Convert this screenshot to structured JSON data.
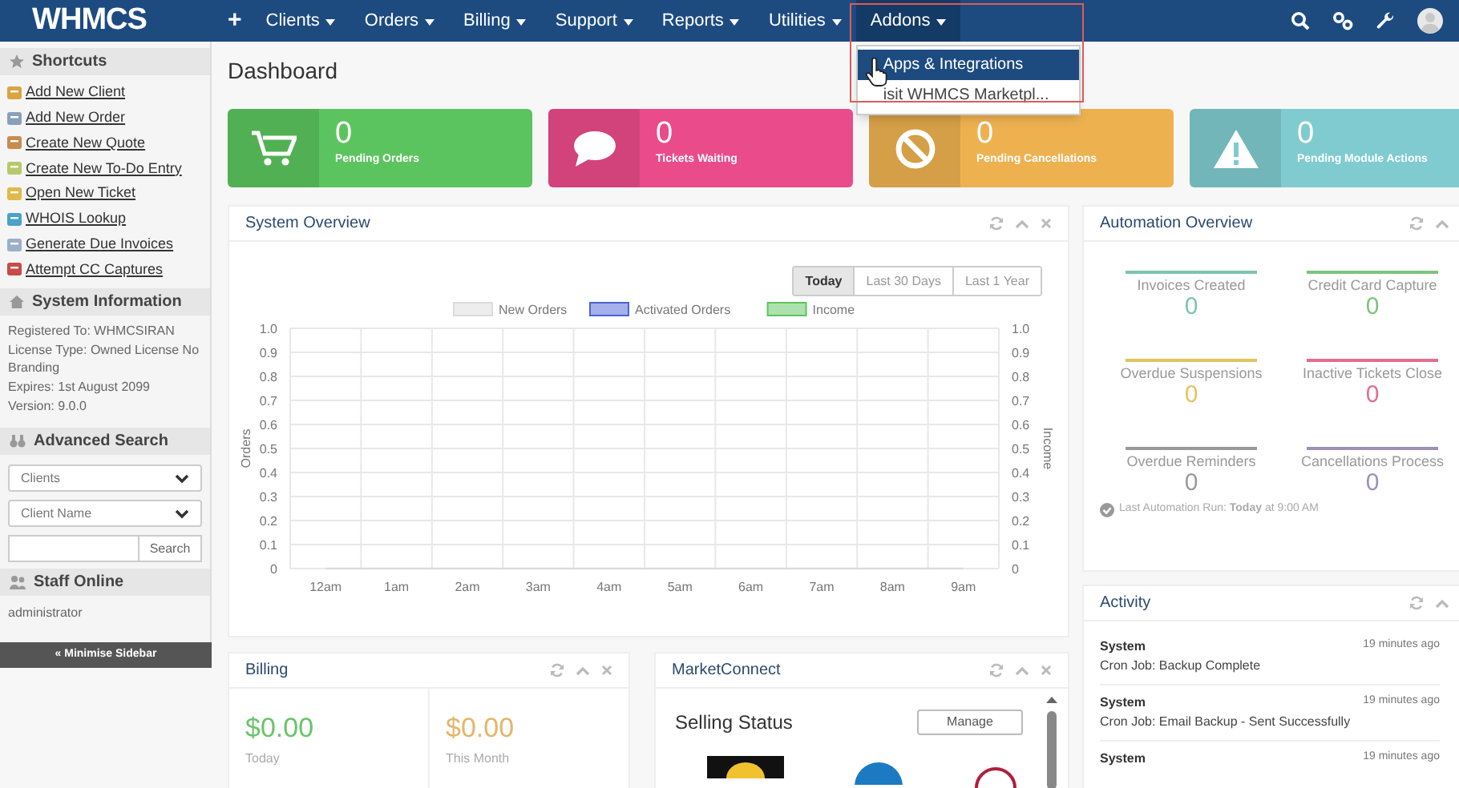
{
  "navbar": {
    "logo": "WHMCS",
    "add_label": "+",
    "items": [
      {
        "label": "Clients",
        "expanded": false
      },
      {
        "label": "Orders",
        "expanded": false
      },
      {
        "label": "Billing",
        "expanded": false
      },
      {
        "label": "Support",
        "expanded": false
      },
      {
        "label": "Reports",
        "expanded": false
      },
      {
        "label": "Utilities",
        "expanded": false
      },
      {
        "label": "Addons",
        "expanded": true,
        "highlighted": true,
        "menu": [
          {
            "label": "Apps & Integrations",
            "selected": true
          },
          {
            "label": "isit WHMCS Marketpl...",
            "selected": false
          }
        ]
      }
    ]
  },
  "sidebar": {
    "shortcuts": {
      "title": "Shortcuts",
      "links": [
        "Add New Client",
        "Add New Order",
        "Create New Quote",
        "Create New To-Do Entry",
        "Open New Ticket",
        "WHOIS Lookup",
        "Generate Due Invoices",
        "Attempt CC Captures"
      ]
    },
    "system_information": {
      "title": "System Information",
      "lines": [
        "Registered To: WHMCSIRAN",
        "License Type: Owned License No Branding",
        "Expires: 1st August 2099",
        "Version: 9.0.0"
      ]
    },
    "advanced_search": {
      "title": "Advanced Search",
      "selects": [
        "Clients",
        "Client Name"
      ],
      "button": "Search"
    },
    "staff_online": {
      "title": "Staff Online",
      "users": [
        "administrator"
      ]
    },
    "minimise": "« Minimise Sidebar"
  },
  "page_title": "Dashboard",
  "stats": [
    {
      "value": "0",
      "label": "Pending Orders",
      "kind": "cart",
      "color": "#5cc45e"
    },
    {
      "value": "0",
      "label": "Tickets Waiting",
      "kind": "chat",
      "color": "#ea4b8b"
    },
    {
      "value": "0",
      "label": "Pending Cancellations",
      "kind": "ban",
      "color": "#eeb150"
    },
    {
      "value": "0",
      "label": "Pending Module Actions",
      "kind": "warning",
      "color": "#7fcbd0"
    }
  ],
  "system_overview": {
    "title": "System Overview",
    "ranges": [
      {
        "label": "Today",
        "selected": true
      },
      {
        "label": "Last 30 Days",
        "selected": false
      },
      {
        "label": "Last 1 Year",
        "selected": false
      }
    ],
    "chart_data": {
      "type": "line",
      "ylabel": "Orders",
      "y2label": "Income",
      "categories": [
        "12am",
        "1am",
        "2am",
        "3am",
        "4am",
        "5am",
        "6am",
        "7am",
        "8am",
        "9am"
      ],
      "series": [
        {
          "name": "New Orders",
          "color": "#dcdcdc",
          "values": [
            0,
            0,
            0,
            0,
            0,
            0,
            0,
            0,
            0,
            0
          ]
        },
        {
          "name": "Activated Orders",
          "color": "#4a63d6",
          "values": [
            null,
            null,
            null,
            null,
            null,
            null,
            null,
            null,
            null,
            null
          ]
        },
        {
          "name": "Income",
          "color": "#5cc45e",
          "values": [
            null,
            null,
            null,
            null,
            null,
            null,
            null,
            null,
            null,
            null
          ]
        }
      ],
      "legend": true,
      "ylim": [
        0,
        1
      ],
      "y2lim": [
        0,
        1
      ],
      "yticks": [
        0,
        0.1,
        0.2,
        0.3,
        0.4,
        0.5,
        0.6,
        0.7,
        0.8,
        0.9,
        {
          "value": 1,
          "label": "1.0"
        }
      ],
      "y2ticks": [
        0,
        0.1,
        0.2,
        0.3,
        0.4,
        0.5,
        0.6,
        0.7,
        0.8,
        0.9,
        {
          "value": 1,
          "label": "1.0"
        }
      ]
    }
  },
  "billing": {
    "title": "Billing",
    "amounts": [
      {
        "value": "$0.00",
        "label": "Today",
        "color": "#6cc36c"
      },
      {
        "value": "$0.00",
        "label": "This Month",
        "color": "#e3b66a"
      }
    ]
  },
  "market_connect": {
    "title": "MarketConnect",
    "heading": "Selling Status",
    "button": "Manage"
  },
  "automation": {
    "title": "Automation Overview",
    "items": [
      {
        "label": "Invoices Created",
        "value": "0",
        "color": "#7dc3b0"
      },
      {
        "label": "Credit Card Capture",
        "value": "0",
        "color": "#7cc47c"
      },
      {
        "label": "Overdue Suspensions",
        "value": "0",
        "color": "#e3c35e"
      },
      {
        "label": "Inactive Tickets Close",
        "value": "0",
        "color": "#e36d8d"
      },
      {
        "label": "Overdue Reminders",
        "value": "0",
        "color": "#9a9a9a"
      },
      {
        "label": "Cancellations Process",
        "value": "0",
        "color": "#9d8fb8"
      }
    ],
    "last_run": "Last Automation Run: **Today** at 9:00 AM"
  },
  "activity": {
    "title": "Activity",
    "entries": [
      {
        "user": "System",
        "message": "Cron Job: Backup Complete",
        "time": "19 minutes ago"
      },
      {
        "user": "System",
        "message": "Cron Job: Email Backup - Sent Successfully",
        "time": "19 minutes ago"
      },
      {
        "user": "System",
        "time": "19 minutes ago"
      }
    ]
  }
}
